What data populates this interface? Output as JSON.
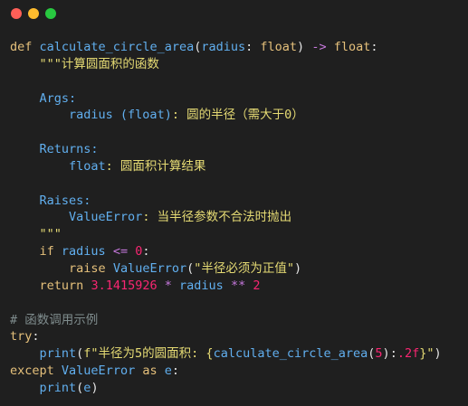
{
  "window": {
    "controls": [
      {
        "name": "close",
        "color": "#ff5f57"
      },
      {
        "name": "minimize",
        "color": "#febc2e"
      },
      {
        "name": "maximize",
        "color": "#28c840"
      }
    ]
  },
  "code": {
    "lines": [
      [
        {
          "t": "def",
          "c": "kw"
        },
        {
          "t": " ",
          "c": "plain"
        },
        {
          "t": "calculate_circle_area",
          "c": "fn"
        },
        {
          "t": "(",
          "c": "plain"
        },
        {
          "t": "radius",
          "c": "param"
        },
        {
          "t": ": ",
          "c": "plain"
        },
        {
          "t": "float",
          "c": "type"
        },
        {
          "t": ") ",
          "c": "plain"
        },
        {
          "t": "->",
          "c": "op"
        },
        {
          "t": " ",
          "c": "plain"
        },
        {
          "t": "float",
          "c": "type"
        },
        {
          "t": ":",
          "c": "plain"
        }
      ],
      [
        {
          "t": "    ",
          "c": "plain"
        },
        {
          "t": "\"\"\"计算圆面积的函数",
          "c": "doc"
        }
      ],
      [],
      [
        {
          "t": "    ",
          "c": "plain"
        },
        {
          "t": "Args:",
          "c": "docsec"
        }
      ],
      [
        {
          "t": "        ",
          "c": "plain"
        },
        {
          "t": "radius (float)",
          "c": "docname"
        },
        {
          "t": ": 圆的半径（需大于0）",
          "c": "doc"
        }
      ],
      [],
      [
        {
          "t": "    ",
          "c": "plain"
        },
        {
          "t": "Returns:",
          "c": "docsec"
        }
      ],
      [
        {
          "t": "        ",
          "c": "plain"
        },
        {
          "t": "float",
          "c": "docname"
        },
        {
          "t": ": 圆面积计算结果",
          "c": "doc"
        }
      ],
      [],
      [
        {
          "t": "    ",
          "c": "plain"
        },
        {
          "t": "Raises:",
          "c": "docsec"
        }
      ],
      [
        {
          "t": "        ",
          "c": "plain"
        },
        {
          "t": "ValueError",
          "c": "docname"
        },
        {
          "t": ": 当半径参数不合法时抛出",
          "c": "doc"
        }
      ],
      [
        {
          "t": "    ",
          "c": "plain"
        },
        {
          "t": "\"\"\"",
          "c": "doc"
        }
      ],
      [
        {
          "t": "    ",
          "c": "plain"
        },
        {
          "t": "if",
          "c": "kw"
        },
        {
          "t": " ",
          "c": "plain"
        },
        {
          "t": "radius",
          "c": "param"
        },
        {
          "t": " ",
          "c": "plain"
        },
        {
          "t": "<=",
          "c": "op"
        },
        {
          "t": " ",
          "c": "plain"
        },
        {
          "t": "0",
          "c": "num"
        },
        {
          "t": ":",
          "c": "plain"
        }
      ],
      [
        {
          "t": "        ",
          "c": "plain"
        },
        {
          "t": "raise",
          "c": "kw"
        },
        {
          "t": " ",
          "c": "plain"
        },
        {
          "t": "ValueError",
          "c": "fn"
        },
        {
          "t": "(",
          "c": "plain"
        },
        {
          "t": "\"半径必须为正值\"",
          "c": "str"
        },
        {
          "t": ")",
          "c": "plain"
        }
      ],
      [
        {
          "t": "    ",
          "c": "plain"
        },
        {
          "t": "return",
          "c": "kw"
        },
        {
          "t": " ",
          "c": "plain"
        },
        {
          "t": "3.1415926",
          "c": "num"
        },
        {
          "t": " ",
          "c": "plain"
        },
        {
          "t": "*",
          "c": "op"
        },
        {
          "t": " ",
          "c": "plain"
        },
        {
          "t": "radius",
          "c": "param"
        },
        {
          "t": " ",
          "c": "plain"
        },
        {
          "t": "**",
          "c": "op"
        },
        {
          "t": " ",
          "c": "plain"
        },
        {
          "t": "2",
          "c": "num"
        }
      ],
      [],
      [
        {
          "t": "# 函数调用示例",
          "c": "comment"
        }
      ],
      [
        {
          "t": "try",
          "c": "kw"
        },
        {
          "t": ":",
          "c": "plain"
        }
      ],
      [
        {
          "t": "    ",
          "c": "plain"
        },
        {
          "t": "print",
          "c": "fn"
        },
        {
          "t": "(",
          "c": "plain"
        },
        {
          "t": "f\"半径为5的圆面积: {",
          "c": "str"
        },
        {
          "t": "calculate_circle_area",
          "c": "fn"
        },
        {
          "t": "(",
          "c": "plain"
        },
        {
          "t": "5",
          "c": "num"
        },
        {
          "t": ")",
          "c": "plain"
        },
        {
          "t": ":",
          "c": "plain"
        },
        {
          "t": ".2f",
          "c": "num"
        },
        {
          "t": "}\"",
          "c": "str"
        },
        {
          "t": ")",
          "c": "plain"
        }
      ],
      [
        {
          "t": "except",
          "c": "kw"
        },
        {
          "t": " ",
          "c": "plain"
        },
        {
          "t": "ValueError",
          "c": "fn"
        },
        {
          "t": " ",
          "c": "plain"
        },
        {
          "t": "as",
          "c": "kw"
        },
        {
          "t": " ",
          "c": "plain"
        },
        {
          "t": "e",
          "c": "param"
        },
        {
          "t": ":",
          "c": "plain"
        }
      ],
      [
        {
          "t": "    ",
          "c": "plain"
        },
        {
          "t": "print",
          "c": "fn"
        },
        {
          "t": "(",
          "c": "plain"
        },
        {
          "t": "e",
          "c": "param"
        },
        {
          "t": ")",
          "c": "plain"
        }
      ]
    ]
  }
}
